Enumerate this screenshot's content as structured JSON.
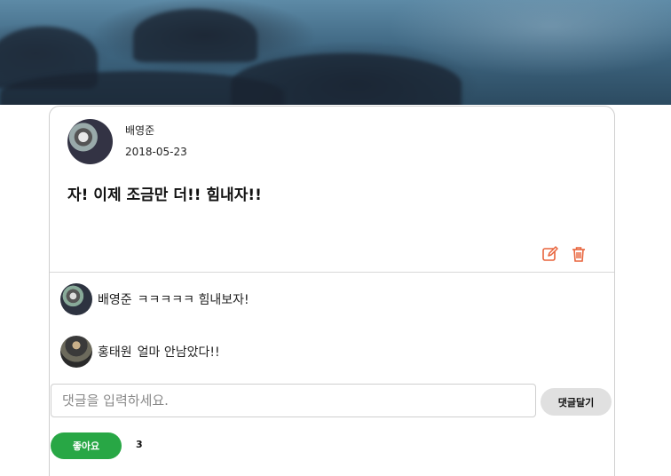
{
  "post": {
    "author": "배영준",
    "date": "2018-05-23",
    "text": "자! 이제 조금만 더!! 힘내자!!"
  },
  "icons": {
    "edit": "edit-icon",
    "delete": "trash-icon",
    "accent": "#e8643c"
  },
  "comments": [
    {
      "author": "배영준",
      "text": "ㅋㅋㅋㅋㅋ 힘내보자!"
    },
    {
      "author": "홍태원",
      "text": "얼마 안남았다!!"
    }
  ],
  "comment_form": {
    "placeholder": "댓글을 입력하세요.",
    "value": "",
    "submit_label": "댓글달기"
  },
  "like": {
    "label": "좋아요",
    "count": "3",
    "color": "#28a745"
  }
}
